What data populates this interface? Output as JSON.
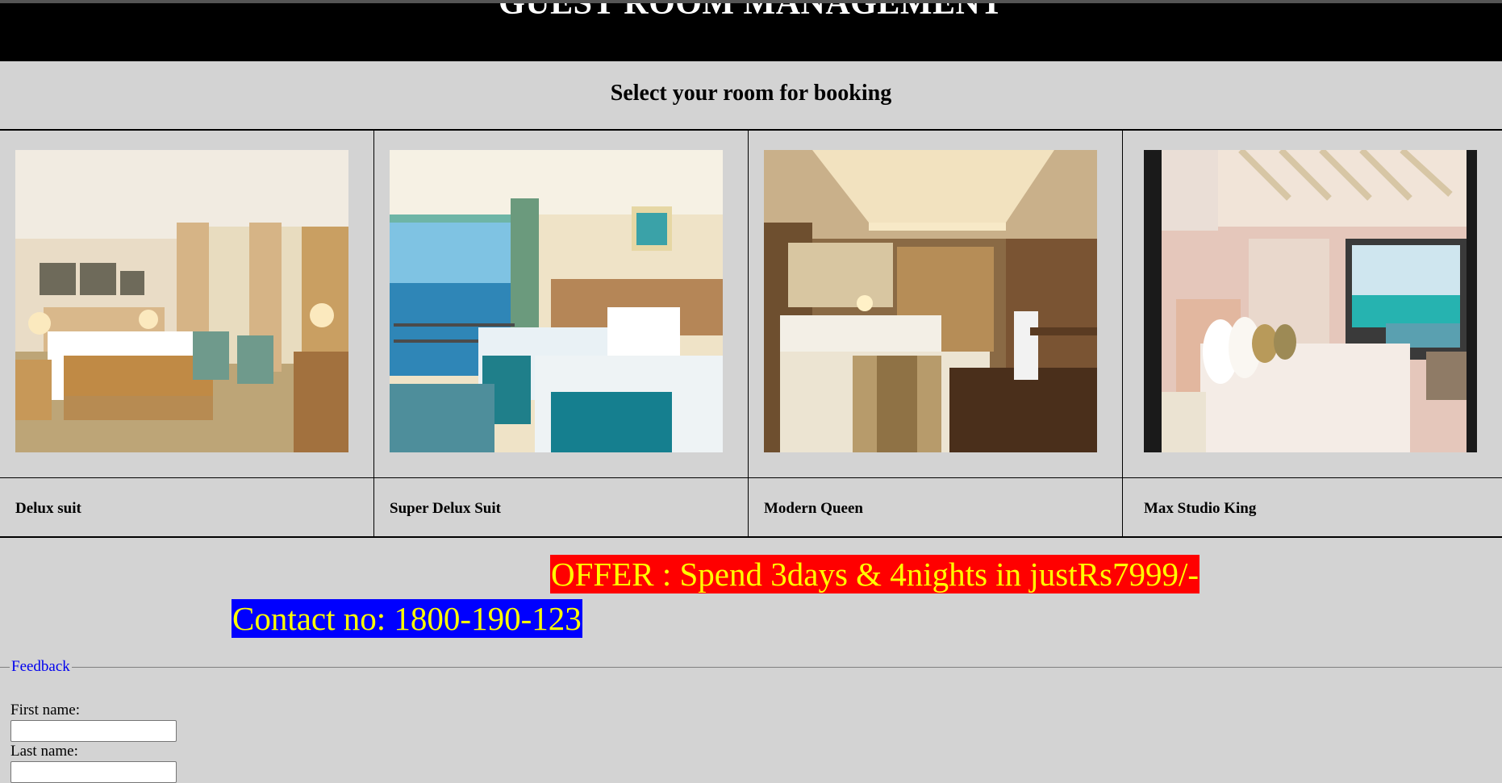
{
  "header": {
    "title": "GUEST ROOM MANAGEMENT"
  },
  "subtitle": "Select your room for booking",
  "rooms": [
    {
      "name": "Delux suit"
    },
    {
      "name": "Super Delux Suit"
    },
    {
      "name": "Modern Queen"
    },
    {
      "name": "Max Studio King"
    }
  ],
  "offer": "OFFER : Spend 3days & 4nights in justRs7999/-",
  "contact": "Contact no: 1800-190-123",
  "feedback": {
    "legend": "Feedback",
    "first_name_label": "First name:",
    "first_name_value": "",
    "last_name_label": "Last name:",
    "last_name_value": ""
  },
  "colors": {
    "page_bg": "#d3d3d3",
    "header_bg": "#000000",
    "offer_bg": "#ff0000",
    "contact_bg": "#0000ff",
    "highlight_text": "#ffff00",
    "legend_text": "#0000ee"
  }
}
